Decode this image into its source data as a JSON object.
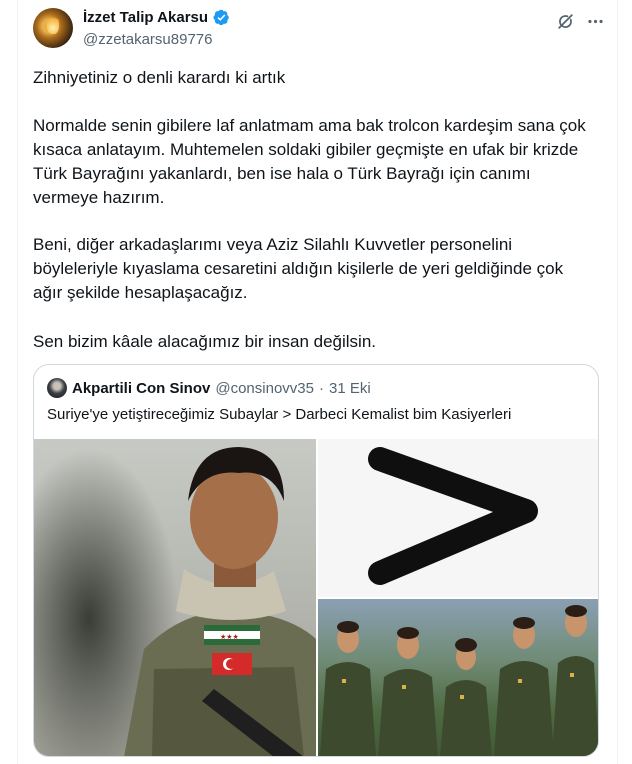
{
  "author": {
    "name": "İzzet Talip Akarsu",
    "handle": "@zzetakarsu89776"
  },
  "icons": {
    "verified": "verified-badge-icon",
    "grok": "grok-icon",
    "more": "more-options-icon",
    "verified_color": "#1d9bf0"
  },
  "tweet": {
    "paragraphs": [
      "Zihniyetiniz o denli karardı ki artık",
      "Normalde senin gibilere laf anlatmam ama bak trolcon kardeşim sana çok kısaca anlatayım. Muhtemelen soldaki gibiler geçmişte en ufak bir krizde Türk Bayrağını yakanlardı, ben ise hala o Türk Bayrağı için canımı vermeye hazırım.",
      "Beni, diğer arkadaşlarımı veya Aziz Silahlı Kuvvetler personelini böyleleriyle kıyaslama cesaretini aldığın kişilerle de yeri geldiğinde çok ağır şekilde hesaplaşacağız.",
      "Sen bizim kâale alacağımız bir insan değilsin."
    ]
  },
  "quoted": {
    "name": "Akpartili Con Sinov",
    "handle": "@consinovv35",
    "separator": "·",
    "date": "31 Eki",
    "text": "Suriye'ye yetiştireceğimiz Subaylar >  Darbeci Kemalist bim Kasiyerleri",
    "symbol": ">"
  }
}
